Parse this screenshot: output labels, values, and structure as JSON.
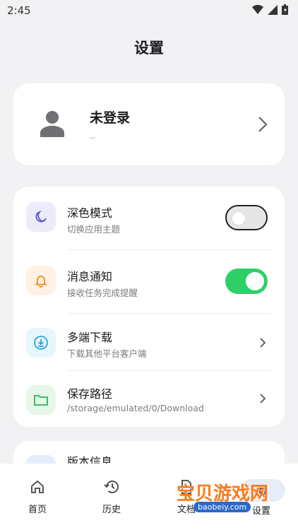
{
  "status_bar": {
    "time": "2:45"
  },
  "header": {
    "title": "设置"
  },
  "profile": {
    "name": "未登录",
    "subtitle": "--"
  },
  "settings": [
    {
      "title": "深色模式",
      "subtitle": "切换应用主题",
      "toggle": false
    },
    {
      "title": "消息通知",
      "subtitle": "接收任务完成提醒",
      "toggle": true
    },
    {
      "title": "多端下载",
      "subtitle": "下载其他平台客户端"
    },
    {
      "title": "保存路径",
      "subtitle": "/storage/emulated/0/Download"
    }
  ],
  "about": {
    "title": "版本信息"
  },
  "nav": [
    {
      "label": "首页"
    },
    {
      "label": "历史"
    },
    {
      "label": "文档"
    },
    {
      "label": "设置"
    }
  ],
  "watermark": {
    "text": "宝贝游戏网",
    "url": "baobeiy.com"
  },
  "colors": {
    "toggle_on": "#2fcf68",
    "dark_icon_bg": "#ecebfa",
    "bell_icon_bg": "#fff1e4",
    "download_icon_bg": "#e6f6fb",
    "folder_icon_bg": "#e6f7ea"
  }
}
